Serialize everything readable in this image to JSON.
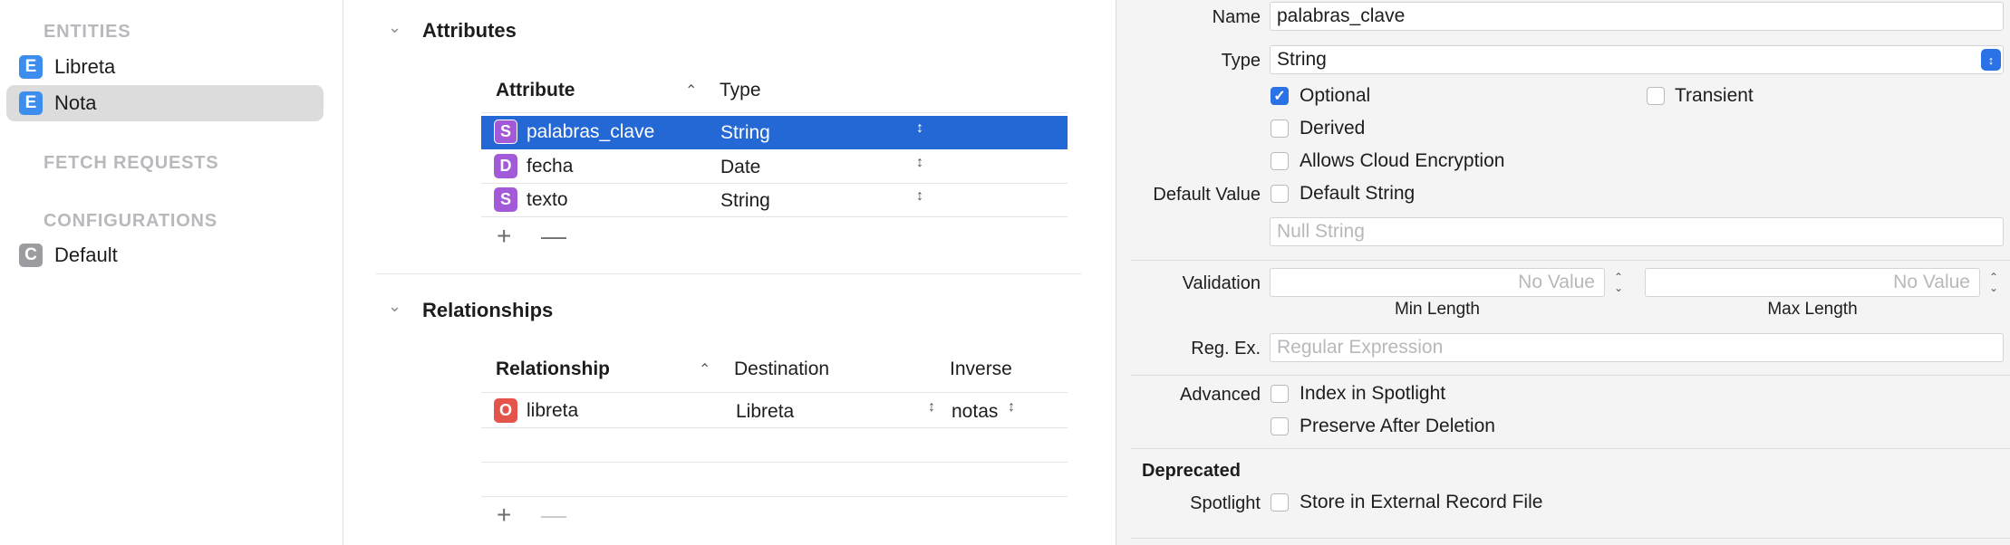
{
  "sidebar": {
    "entities_header": "ENTITIES",
    "entities": [
      {
        "badge": "E",
        "label": "Libreta",
        "selected": false
      },
      {
        "badge": "E",
        "label": "Nota",
        "selected": true
      }
    ],
    "fetch_header": "FETCH REQUESTS",
    "config_header": "CONFIGURATIONS",
    "configurations": [
      {
        "badge": "C",
        "label": "Default"
      }
    ]
  },
  "attributes": {
    "title": "Attributes",
    "col_attribute": "Attribute",
    "col_type": "Type",
    "rows": [
      {
        "badge": "S",
        "name": "palabras_clave",
        "type": "String",
        "selected": true
      },
      {
        "badge": "D",
        "name": "fecha",
        "type": "Date",
        "selected": false
      },
      {
        "badge": "S",
        "name": "texto",
        "type": "String",
        "selected": false
      }
    ],
    "add": "+",
    "remove": "—"
  },
  "relationships": {
    "title": "Relationships",
    "col_relationship": "Relationship",
    "col_destination": "Destination",
    "col_inverse": "Inverse",
    "rows": [
      {
        "badge": "O",
        "name": "libreta",
        "destination": "Libreta",
        "inverse": "notas"
      }
    ],
    "add": "+",
    "remove": "—"
  },
  "inspector": {
    "name_label": "Name",
    "name_value": "palabras_clave",
    "type_label": "Type",
    "type_value": "String",
    "optional_label": "Optional",
    "optional_checked": true,
    "transient_label": "Transient",
    "derived_label": "Derived",
    "cloud_label": "Allows Cloud Encryption",
    "default_value_label": "Default Value",
    "default_string_label": "Default String",
    "null_string_placeholder": "Null String",
    "validation_label": "Validation",
    "min_placeholder": "No Value",
    "max_placeholder": "No Value",
    "min_length_label": "Min Length",
    "max_length_label": "Max Length",
    "regex_label": "Reg. Ex.",
    "regex_placeholder": "Regular Expression",
    "advanced_label": "Advanced",
    "spotlight_index_label": "Index in Spotlight",
    "preserve_label": "Preserve After Deletion",
    "deprecated_header": "Deprecated",
    "spotlight_label": "Spotlight",
    "external_record_label": "Store in External Record File"
  },
  "colors": {
    "selection_blue": "#2468d6",
    "entity_badge": "#3c8dee",
    "attribute_badge": "#a35ad8",
    "relationship_badge": "#e4544a"
  }
}
